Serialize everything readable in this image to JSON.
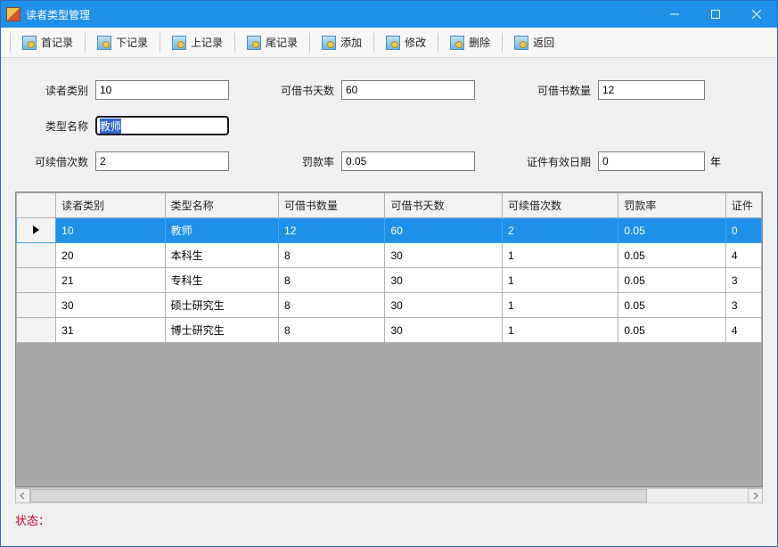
{
  "window": {
    "title": "读者类型管理"
  },
  "toolbar": {
    "first": "首记录",
    "next": "下记录",
    "prev": "上记录",
    "last": "尾记录",
    "add": "添加",
    "edit": "修改",
    "delete": "删除",
    "back": "返回"
  },
  "form": {
    "reader_type_label": "读者类别",
    "reader_type_value": "10",
    "type_name_label": "类型名称",
    "type_name_value": "教师",
    "renew_count_label": "可续借次数",
    "renew_count_value": "2",
    "borrow_days_label": "可借书天数",
    "borrow_days_value": "60",
    "fine_rate_label": "罚款率",
    "fine_rate_value": "0.05",
    "borrow_qty_label": "可借书数量",
    "borrow_qty_value": "12",
    "cert_valid_label": "证件有效日期",
    "cert_valid_value": "0",
    "year_suffix": "年"
  },
  "grid": {
    "headers": {
      "c0": "读者类别",
      "c1": "类型名称",
      "c2": "可借书数量",
      "c3": "可借书天数",
      "c4": "可续借次数",
      "c5": "罚款率",
      "c6": "证件"
    },
    "rows": [
      {
        "selected": true,
        "c0": "10",
        "c1": "教师",
        "c2": "12",
        "c3": "60",
        "c4": "2",
        "c5": "0.05",
        "c6": "0"
      },
      {
        "selected": false,
        "c0": "20",
        "c1": "本科生",
        "c2": "8",
        "c3": "30",
        "c4": "1",
        "c5": "0.05",
        "c6": "4"
      },
      {
        "selected": false,
        "c0": "21",
        "c1": "专科生",
        "c2": "8",
        "c3": "30",
        "c4": "1",
        "c5": "0.05",
        "c6": "3"
      },
      {
        "selected": false,
        "c0": "30",
        "c1": "硕士研究生",
        "c2": "8",
        "c3": "30",
        "c4": "1",
        "c5": "0.05",
        "c6": "3"
      },
      {
        "selected": false,
        "c0": "31",
        "c1": "博士研究生",
        "c2": "8",
        "c3": "30",
        "c4": "1",
        "c5": "0.05",
        "c6": "4"
      }
    ]
  },
  "status": {
    "label": "状态：",
    "value": ""
  }
}
